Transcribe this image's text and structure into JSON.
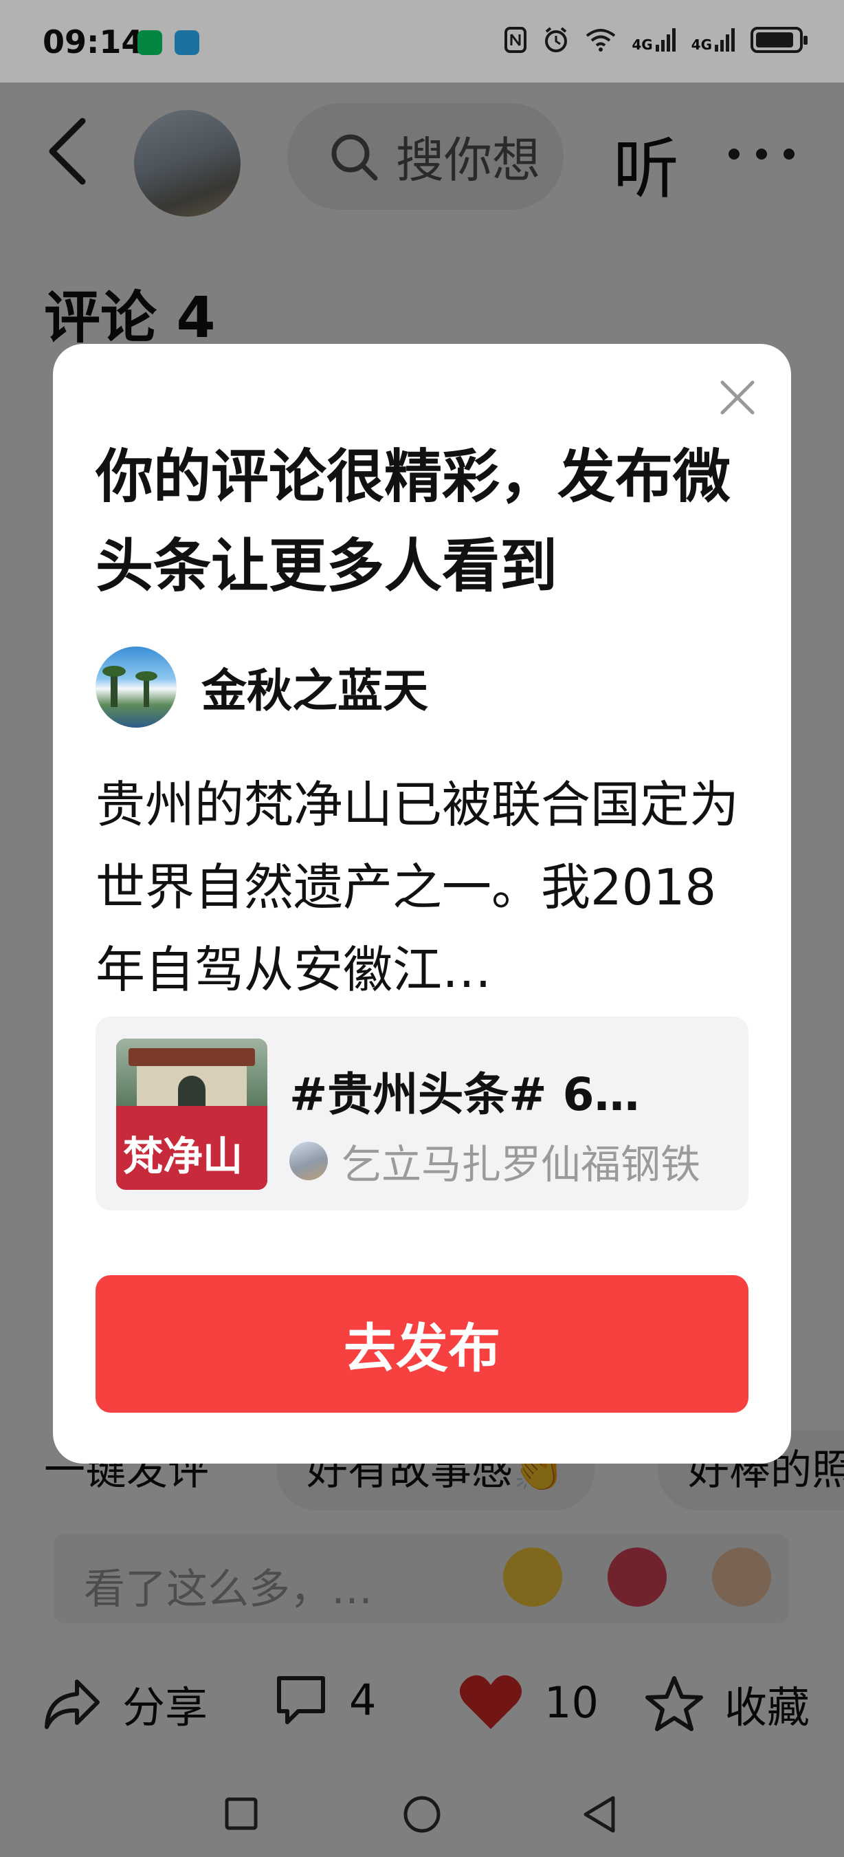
{
  "status_bar": {
    "time": "09:14",
    "net1": "4G",
    "net2": "4G",
    "icons": [
      "wechat-icon",
      "telegram-icon",
      "nfc-icon",
      "alarm-icon",
      "wifi-icon",
      "signal-icon",
      "battery-icon"
    ]
  },
  "header": {
    "search_placeholder": "搜你想",
    "listen_label": "听"
  },
  "comments": {
    "title": "评论 4"
  },
  "quick_replies": {
    "items": [
      "一键发评",
      "好有故事感👏",
      "好棒的照"
    ]
  },
  "input": {
    "placeholder": "看了这么多，…"
  },
  "actions": {
    "share_label": "分享",
    "comment_count": "4",
    "like_count": "10",
    "favorite_label": "收藏"
  },
  "modal": {
    "title": "你的评论很精彩，发布微头条让更多人看到",
    "author_name": "金秋之蓝天",
    "comment": "贵州的梵净山已被联合国定为世界自然遗产之一。我2018年自驾从安徽江…",
    "article_title": "#贵州头条# 6…",
    "article_source": "乞立马扎罗仙福钢铁",
    "thumb_caption": "梵净山",
    "publish_label": "去发布"
  },
  "colors": {
    "publish_button": "#f74040",
    "like_heart": "#e52b2b",
    "overlay": "rgba(0,0,0,0.5)"
  }
}
